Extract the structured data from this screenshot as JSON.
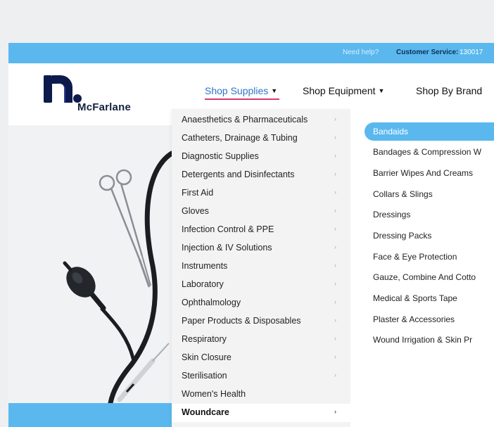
{
  "topbar": {
    "help": "Need help?",
    "customer_service_label": "Customer Service:",
    "phone": "130017"
  },
  "brand": {
    "name": "McFarlane",
    "logo_icon": "mcfarlane-logo-icon",
    "colors": {
      "navy": "#0d1b4c",
      "accent_blue": "#5ab8ee",
      "underline_pink": "#d63a6f",
      "link_blue": "#2f74c6"
    }
  },
  "nav": {
    "items": [
      {
        "label": "Shop Supplies",
        "active": true
      },
      {
        "label": "Shop Equipment",
        "active": false
      },
      {
        "label": "Shop By Brand",
        "active": false
      }
    ]
  },
  "categories": [
    "Anaesthetics & Pharmaceuticals",
    "Catheters, Drainage & Tubing",
    "Diagnostic Supplies",
    "Detergents and Disinfectants",
    "First Aid",
    "Gloves",
    "Infection Control & PPE",
    "Injection & IV Solutions",
    "Instruments",
    "Laboratory",
    "Ophthalmology",
    "Paper Products & Disposables",
    "Respiratory",
    "Skin Closure",
    "Sterilisation",
    "Women's Health",
    "Woundcare"
  ],
  "active_category": "Woundcare",
  "subcategories": [
    "Bandaids",
    "Bandages & Compression W",
    "Barrier Wipes And Creams",
    "Collars & Slings",
    "Dressings",
    "Dressing Packs",
    "Face & Eye Protection",
    "Gauze, Combine And Cotto",
    "Medical & Sports Tape",
    "Plaster & Accessories",
    "Wound Irrigation & Skin Pr"
  ],
  "selected_subcategory": "Bandaids"
}
